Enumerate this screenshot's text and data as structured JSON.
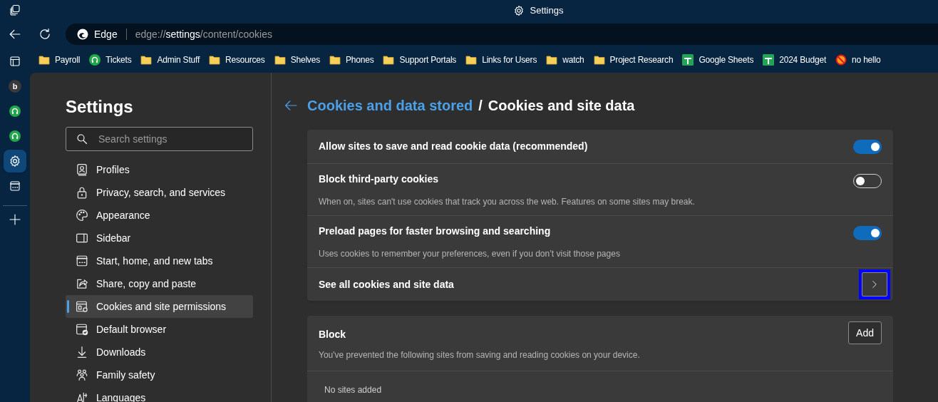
{
  "window": {
    "title": "Settings"
  },
  "address_bar": {
    "site_label": "Edge",
    "url_prefix": "edge://",
    "url_host": "settings",
    "url_path": "/content/cookies"
  },
  "bookmarks": [
    {
      "kind": "folder",
      "label": "Payroll"
    },
    {
      "kind": "headset",
      "label": "Tickets"
    },
    {
      "kind": "folder",
      "label": "Admin Stuff"
    },
    {
      "kind": "folder",
      "label": "Resources"
    },
    {
      "kind": "folder",
      "label": "Shelves"
    },
    {
      "kind": "folder",
      "label": "Phones"
    },
    {
      "kind": "folder",
      "label": "Support Portals"
    },
    {
      "kind": "folder",
      "label": "Links for Users"
    },
    {
      "kind": "folder",
      "label": "watch"
    },
    {
      "kind": "folder",
      "label": "Project Research"
    },
    {
      "kind": "sheet",
      "label": "Google Sheets"
    },
    {
      "kind": "sheet",
      "label": "2024 Budget"
    },
    {
      "kind": "blocked",
      "label": "no hello"
    }
  ],
  "sidebar_apps": [
    {
      "kind": "letter",
      "label": "b",
      "selected": false
    },
    {
      "kind": "headset",
      "selected": false
    },
    {
      "kind": "headset",
      "selected": false
    },
    {
      "kind": "settings",
      "selected": true
    },
    {
      "kind": "start",
      "selected": false
    }
  ],
  "settings_nav": {
    "title": "Settings",
    "search_placeholder": "Search settings",
    "items": [
      {
        "kind": "profile",
        "label": "Profiles",
        "selected": false
      },
      {
        "kind": "lock",
        "label": "Privacy, search, and services",
        "selected": false
      },
      {
        "kind": "palette",
        "label": "Appearance",
        "selected": false
      },
      {
        "kind": "sidebar",
        "label": "Sidebar",
        "selected": false
      },
      {
        "kind": "start",
        "label": "Start, home, and new tabs",
        "selected": false
      },
      {
        "kind": "share",
        "label": "Share, copy and paste",
        "selected": false
      },
      {
        "kind": "cookie",
        "label": "Cookies and site permissions",
        "selected": true
      },
      {
        "kind": "browser",
        "label": "Default browser",
        "selected": false
      },
      {
        "kind": "download",
        "label": "Downloads",
        "selected": false
      },
      {
        "kind": "family",
        "label": "Family safety",
        "selected": false
      },
      {
        "kind": "language",
        "label": "Languages",
        "selected": false
      }
    ]
  },
  "breadcrumb": {
    "parent": "Cookies and data stored",
    "separator": "/",
    "current": "Cookies and site data"
  },
  "settings": [
    {
      "kind": "toggle",
      "title": "Allow sites to save and read cookie data (recommended)",
      "on": true
    },
    {
      "kind": "toggle",
      "title": "Block third-party cookies",
      "description": "When on, sites can't use cookies that track you across the web. Features on some sites may break.",
      "on": false
    },
    {
      "kind": "toggle",
      "title": "Preload pages for faster browsing and searching",
      "description": "Uses cookies to remember your preferences, even if you don’t visit those pages",
      "on": true
    },
    {
      "kind": "link",
      "title": "See all cookies and site data",
      "highlighted": true
    }
  ],
  "block_section": {
    "title": "Block",
    "button": "Add",
    "description": "You've prevented the following sites from saving and reading cookies on your device.",
    "empty_text": "No sites added"
  }
}
